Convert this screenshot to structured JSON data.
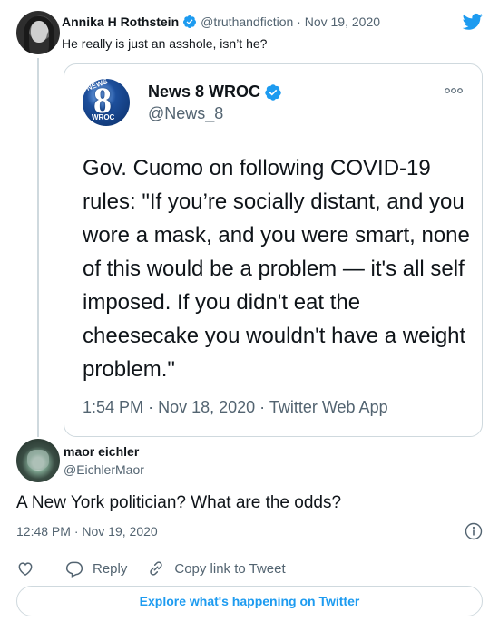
{
  "parent_tweet": {
    "name": "Annika H Rothstein",
    "handle": "@truthandfiction",
    "separator": "·",
    "date": "Nov 19, 2020",
    "text": "He really is just an asshole, isn’t he?"
  },
  "quoted_tweet": {
    "name": "News 8 WROC",
    "handle": "@News_8",
    "avatar_text": {
      "top": "NEWS",
      "number": "8",
      "bottom": "WROC"
    },
    "text": "Gov. Cuomo on following COVID-19 rules: \"If you’re socially distant, and you wore a mask, and you were smart, none of this would be a problem — it's all self imposed. If you didn't eat the cheesecake you wouldn't have a weight problem.\"",
    "time": "1:54 PM",
    "date": "Nov 18, 2020",
    "source": "Twitter Web App",
    "separator": "·"
  },
  "reply_tweet": {
    "name": "maor eichler",
    "handle": "@EichlerMaor",
    "text": "A New York politician? What are the odds?",
    "time": "12:48 PM",
    "date": "Nov 19, 2020",
    "separator": "·"
  },
  "actions": {
    "reply_label": "Reply",
    "copy_label": "Copy link to Tweet"
  },
  "footer": {
    "explore_label": "Explore what's happening on Twitter"
  },
  "colors": {
    "accent": "#1d9bf0",
    "text": "#0f1419",
    "secondary": "#536471",
    "border": "#cfd9de"
  },
  "icons": [
    "verified-badge-icon",
    "twitter-bird-icon",
    "more-options-icon",
    "info-icon",
    "heart-icon",
    "reply-icon",
    "link-icon"
  ]
}
